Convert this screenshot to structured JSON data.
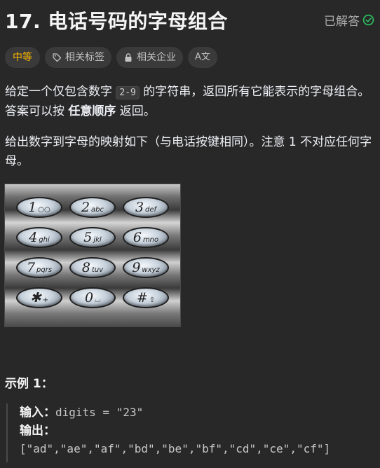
{
  "header": {
    "title": "17. 电话号码的字母组合",
    "status_label": "已解答",
    "status_color": "#2cbb5d"
  },
  "tags": {
    "difficulty": "中等",
    "related_tags": "相关标签",
    "related_companies": "相关企业",
    "translate_icon_text": "A文"
  },
  "description": {
    "p1_before": "给定一个仅包含数字 ",
    "p1_code": "2-9",
    "p1_mid": " 的字符串，返回所有它能表示的字母组合。答案可以按 ",
    "p1_bold": "任意顺序",
    "p1_after": " 返回。",
    "p2": "给出数字到字母的映射如下（与电话按键相同）。注意 1 不对应任何字母。"
  },
  "keypad": [
    {
      "num": "1",
      "letters": "○○"
    },
    {
      "num": "2",
      "letters": "abc"
    },
    {
      "num": "3",
      "letters": "def"
    },
    {
      "num": "4",
      "letters": "ghi"
    },
    {
      "num": "5",
      "letters": "jkl"
    },
    {
      "num": "6",
      "letters": "mno"
    },
    {
      "num": "7",
      "letters": "pqrs"
    },
    {
      "num": "8",
      "letters": "tuv"
    },
    {
      "num": "9",
      "letters": "wxyz"
    },
    {
      "num": "✱",
      "letters": "+"
    },
    {
      "num": "0",
      "letters": "⌴"
    },
    {
      "num": "#",
      "letters": "⇧"
    }
  ],
  "example": {
    "title": "示例 1：",
    "input_label": "输入：",
    "input_value": "digits = \"23\"",
    "output_label": "输出：",
    "output_value": "[\"ad\",\"ae\",\"af\",\"bd\",\"be\",\"bf\",\"cd\",\"ce\",\"cf\"]"
  }
}
